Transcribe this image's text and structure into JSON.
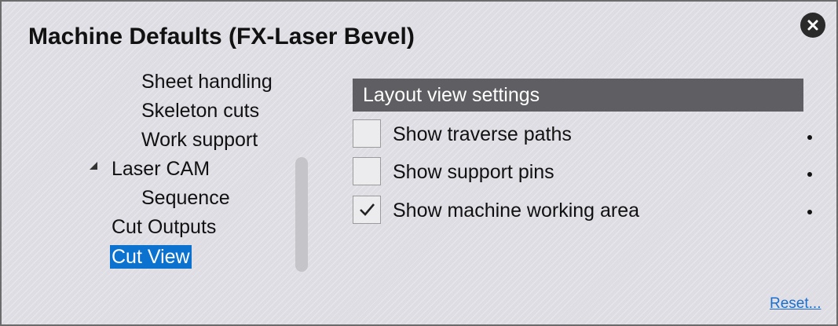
{
  "dialog": {
    "title": "Machine Defaults (FX-Laser Bevel)",
    "close_icon": "close-icon"
  },
  "tree": {
    "items": [
      {
        "label": "Sheet handling",
        "level": 2
      },
      {
        "label": "Skeleton cuts",
        "level": 2
      },
      {
        "label": "Work support",
        "level": 2
      },
      {
        "label": "Laser CAM",
        "level": 1,
        "expanded": true
      },
      {
        "label": "Sequence",
        "level": 2
      },
      {
        "label": "Cut Outputs",
        "level": 1
      },
      {
        "label": "Cut View",
        "level": 1,
        "selected": true
      }
    ],
    "expander_icon": "triangle-expanded-icon"
  },
  "settings": {
    "section_title": "Layout view settings",
    "options": [
      {
        "label": "Show traverse paths",
        "checked": false
      },
      {
        "label": "Show support pins",
        "checked": false
      },
      {
        "label": "Show machine working area",
        "checked": true
      }
    ],
    "bullet_icon": "bullet-dot-icon"
  },
  "footer": {
    "reset_label": "Reset..."
  },
  "colors": {
    "selection": "#0b72d0",
    "header_bg": "#5f5f63",
    "link": "#1a6fd0",
    "background": "#dddde3"
  }
}
